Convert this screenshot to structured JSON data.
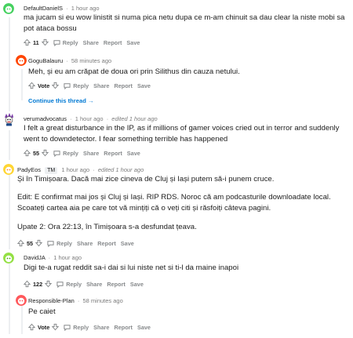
{
  "comments": [
    {
      "author": "DefaultDanielS",
      "time": "1 hour ago",
      "body": [
        "ma jucam si eu wow linistit si numa pica netu dupa ce m-am chinuit sa dau clear la niste mobi sa",
        "pot ataca bossu"
      ],
      "votes": "11",
      "actions": [
        "Reply",
        "Share",
        "Report",
        "Save"
      ]
    },
    {
      "author": "GoguBalauru",
      "time": "58 minutes ago",
      "body": [
        "Meh, și eu am crăpat de doua ori prin Silithus din cauza netului."
      ],
      "votes": "Vote",
      "actions": [
        "Reply",
        "Share",
        "Report",
        "Save"
      ],
      "continue": "Continue this thread"
    },
    {
      "author": "verumadvocatus",
      "time": "1 hour ago",
      "edited": "edited 1 hour ago",
      "body": [
        "I felt a great disturbance in the IP, as if millions of gamer voices cried out in terror and suddenly",
        "went to downdetector. I fear something terrible has happened"
      ],
      "votes": "55",
      "actions": [
        "Reply",
        "Share",
        "Report",
        "Save"
      ]
    },
    {
      "author": "PadyEos",
      "flair": "TM",
      "time": "1 hour ago",
      "edited": "edited 1 hour ago",
      "body": [
        "Și în Timișoara. Dacă mai zice cineva de Cluj și Iași putem să-i punem cruce.",
        "Edit: E confirmat mai jos și Cluj și Iași. RIP RDS. Noroc că am podcasturile downloadate local.",
        "Scoateți cartea aia pe care tot vă mințiți că o veți citi și răsfoiți câteva pagini.",
        "Upate 2: Ora 22:13, în Timișoara s-a desfundat țeava."
      ],
      "votes": "55",
      "actions": [
        "Reply",
        "Share",
        "Report",
        "Save"
      ]
    },
    {
      "author": "DavidJA",
      "time": "1 hour ago",
      "body": [
        "Digi te-a rugat reddit sa-i dai si lui niste net si ti-l da maine inapoi"
      ],
      "votes": "122",
      "actions": [
        "Reply",
        "Share",
        "Report",
        "Save"
      ]
    },
    {
      "author": "Responsible-Plan",
      "time": "58 minutes ago",
      "body": [
        "Pe caiet"
      ],
      "votes": "Vote",
      "actions": [
        "Reply",
        "Share",
        "Report",
        "Save"
      ]
    }
  ],
  "colors": {
    "link": "#0079d3",
    "meta": "#7c7c7c",
    "action": "#878a8c",
    "thread_line": "#edeff1"
  }
}
